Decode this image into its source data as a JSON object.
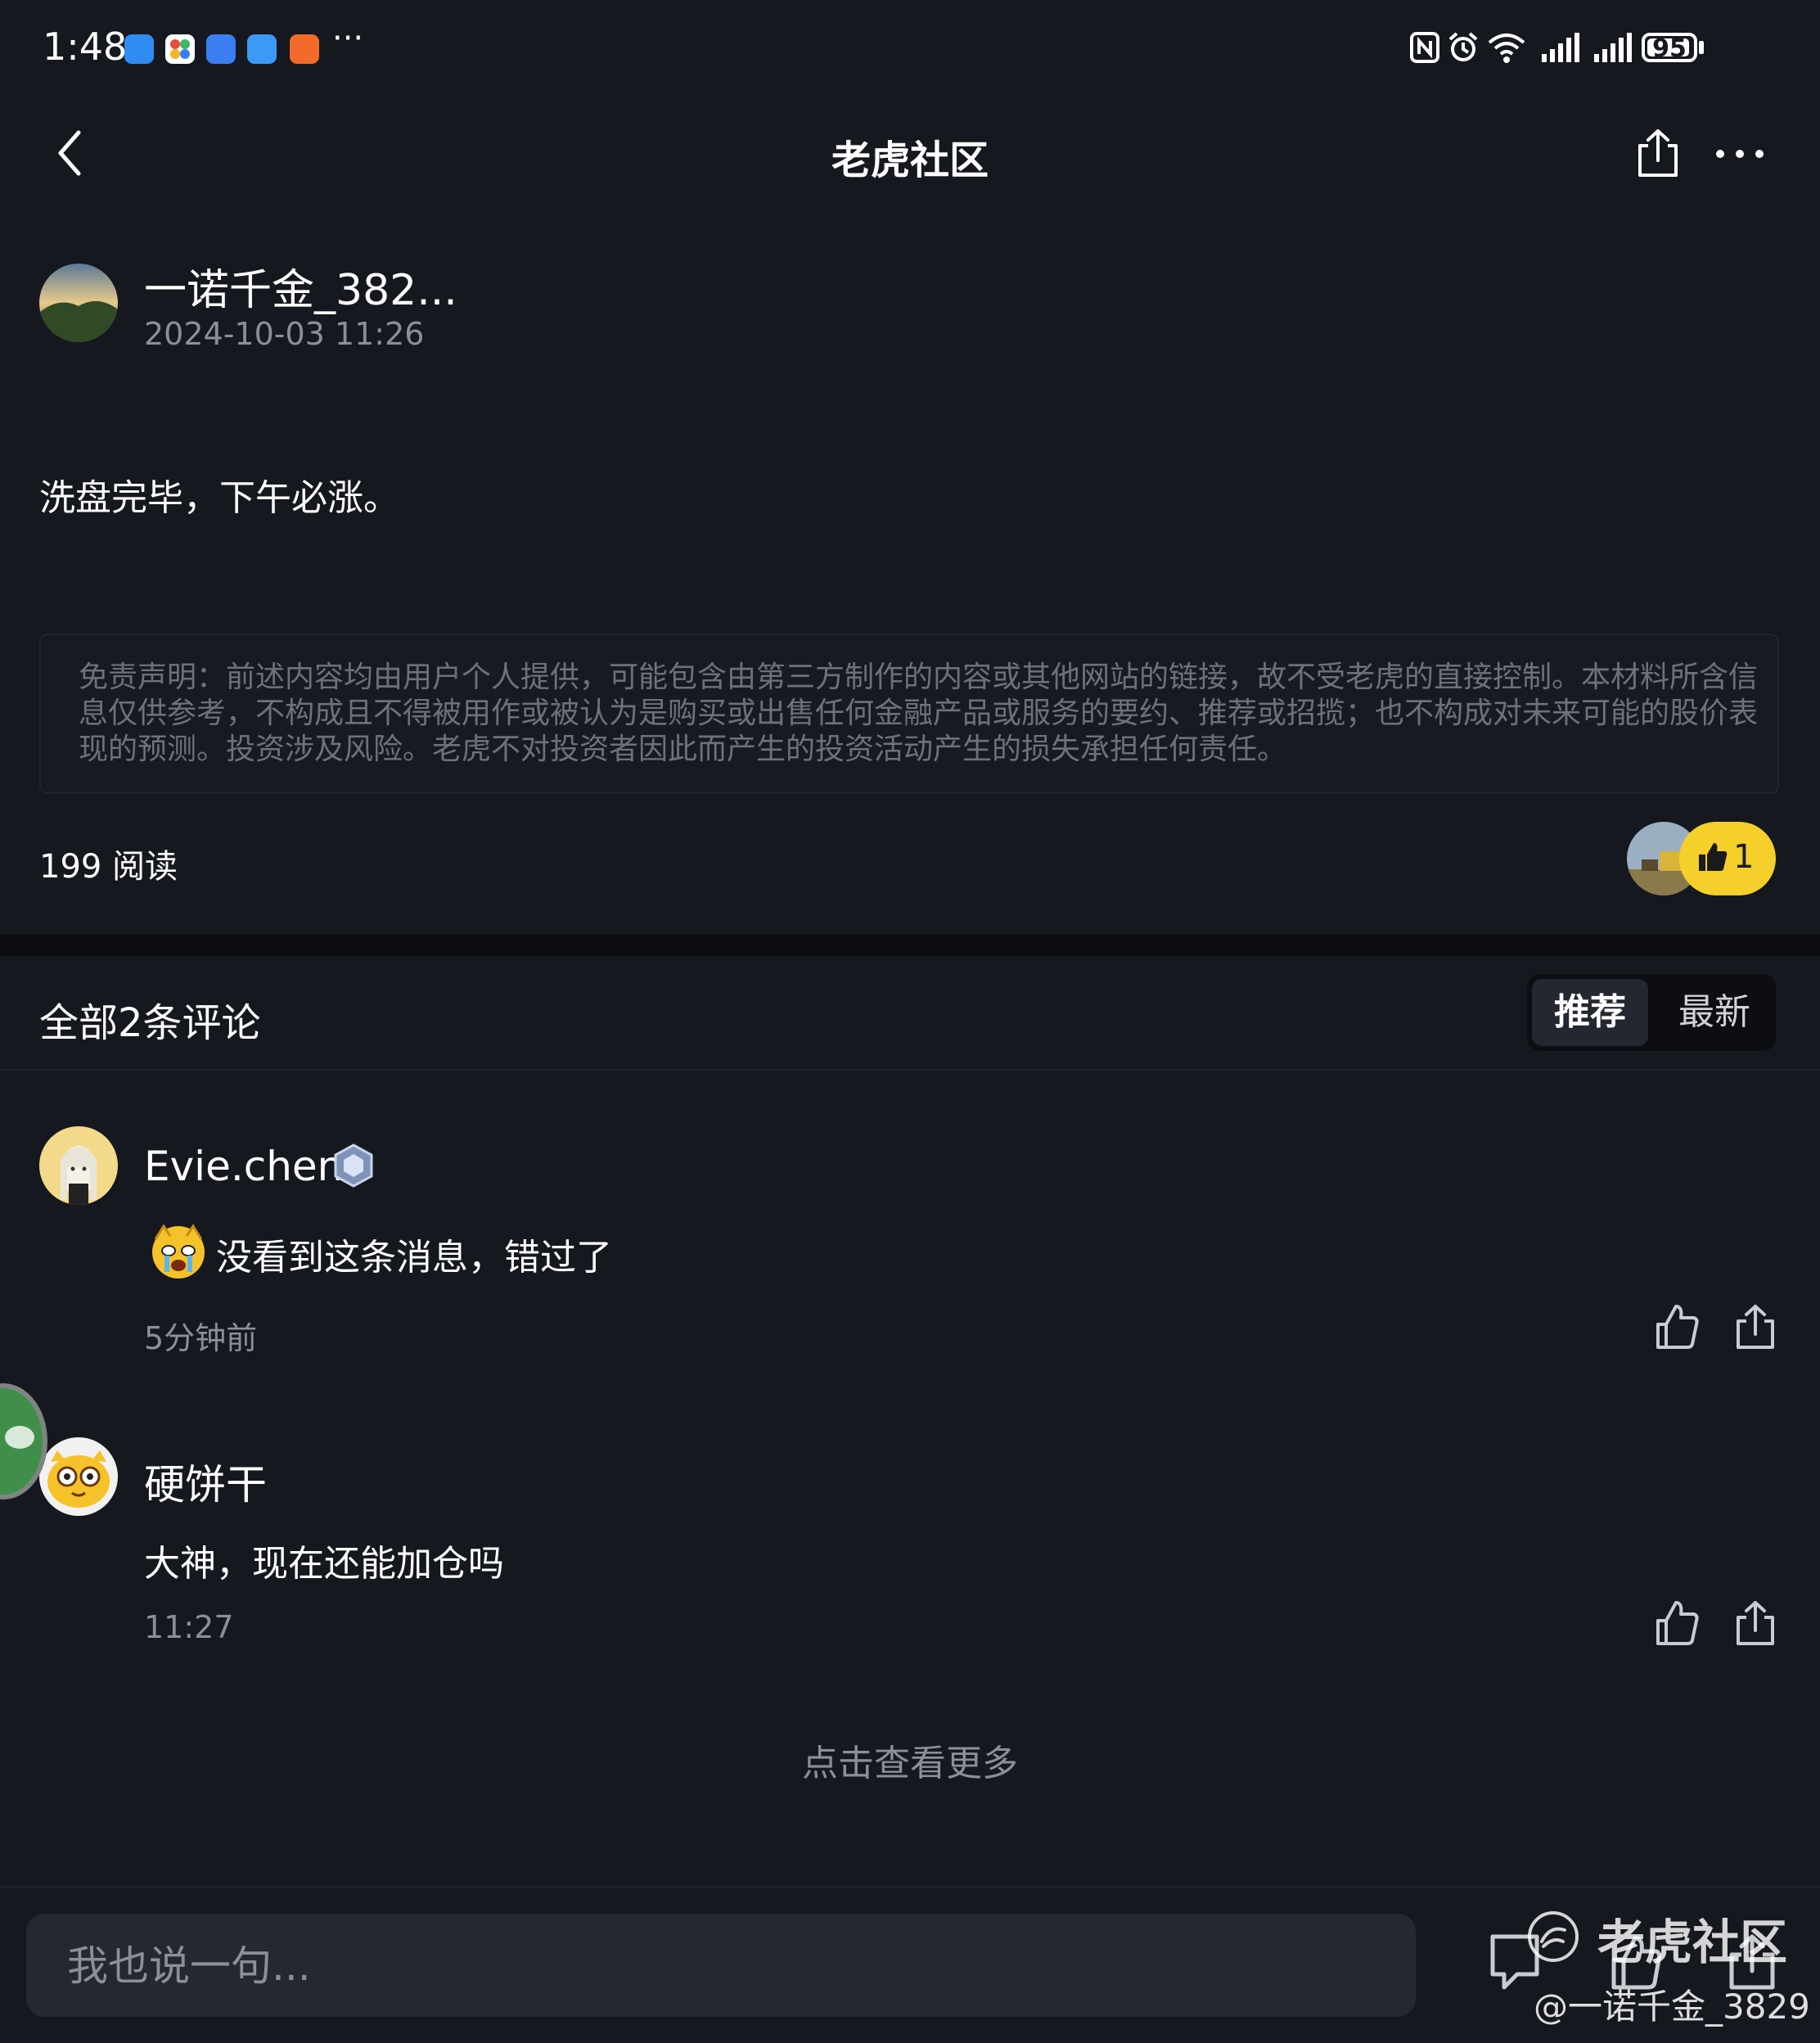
{
  "status_bar": {
    "time": "1:48",
    "more": "···",
    "battery": "95",
    "battery_level": 0.95
  },
  "nav": {
    "title": "老虎社区"
  },
  "post": {
    "author": "一诺千金_382...",
    "date": "2024-10-03 11:26",
    "body": "洗盘完毕，下午必涨。",
    "disclaimer": "免责声明：前述内容均由用户个人提供，可能包含由第三方制作的内容或其他网站的链接，故不受老虎的直接控制。本材料所含信息仅供参考，不构成且不得被用作或被认为是购买或出售任何金融产品或服务的要约、推荐或招揽；也不构成对未来可能的股价表现的预测。投资涉及风险。老虎不对投资者因此而产生的投资活动产生的损失承担任何责任。",
    "reads": "199 阅读",
    "like_count": "1"
  },
  "comments_section": {
    "title": "全部2条评论",
    "tabs": [
      {
        "label": "推荐",
        "active": true
      },
      {
        "label": "最新",
        "active": false
      }
    ]
  },
  "comments": [
    {
      "name": "Evie.chen",
      "text": "没看到这条消息，错过了",
      "time": "5分钟前"
    },
    {
      "name": "硬饼干",
      "text": "大神，现在还能加仓吗",
      "time": "11:27"
    }
  ],
  "load_more": "点击查看更多",
  "input": {
    "placeholder": "我也说一句..."
  },
  "watermark": {
    "brand": "老虎社区",
    "user": "@一诺千金_3829"
  },
  "colors": {
    "background": "#16181f",
    "accent_like": "#f5cf2a"
  }
}
